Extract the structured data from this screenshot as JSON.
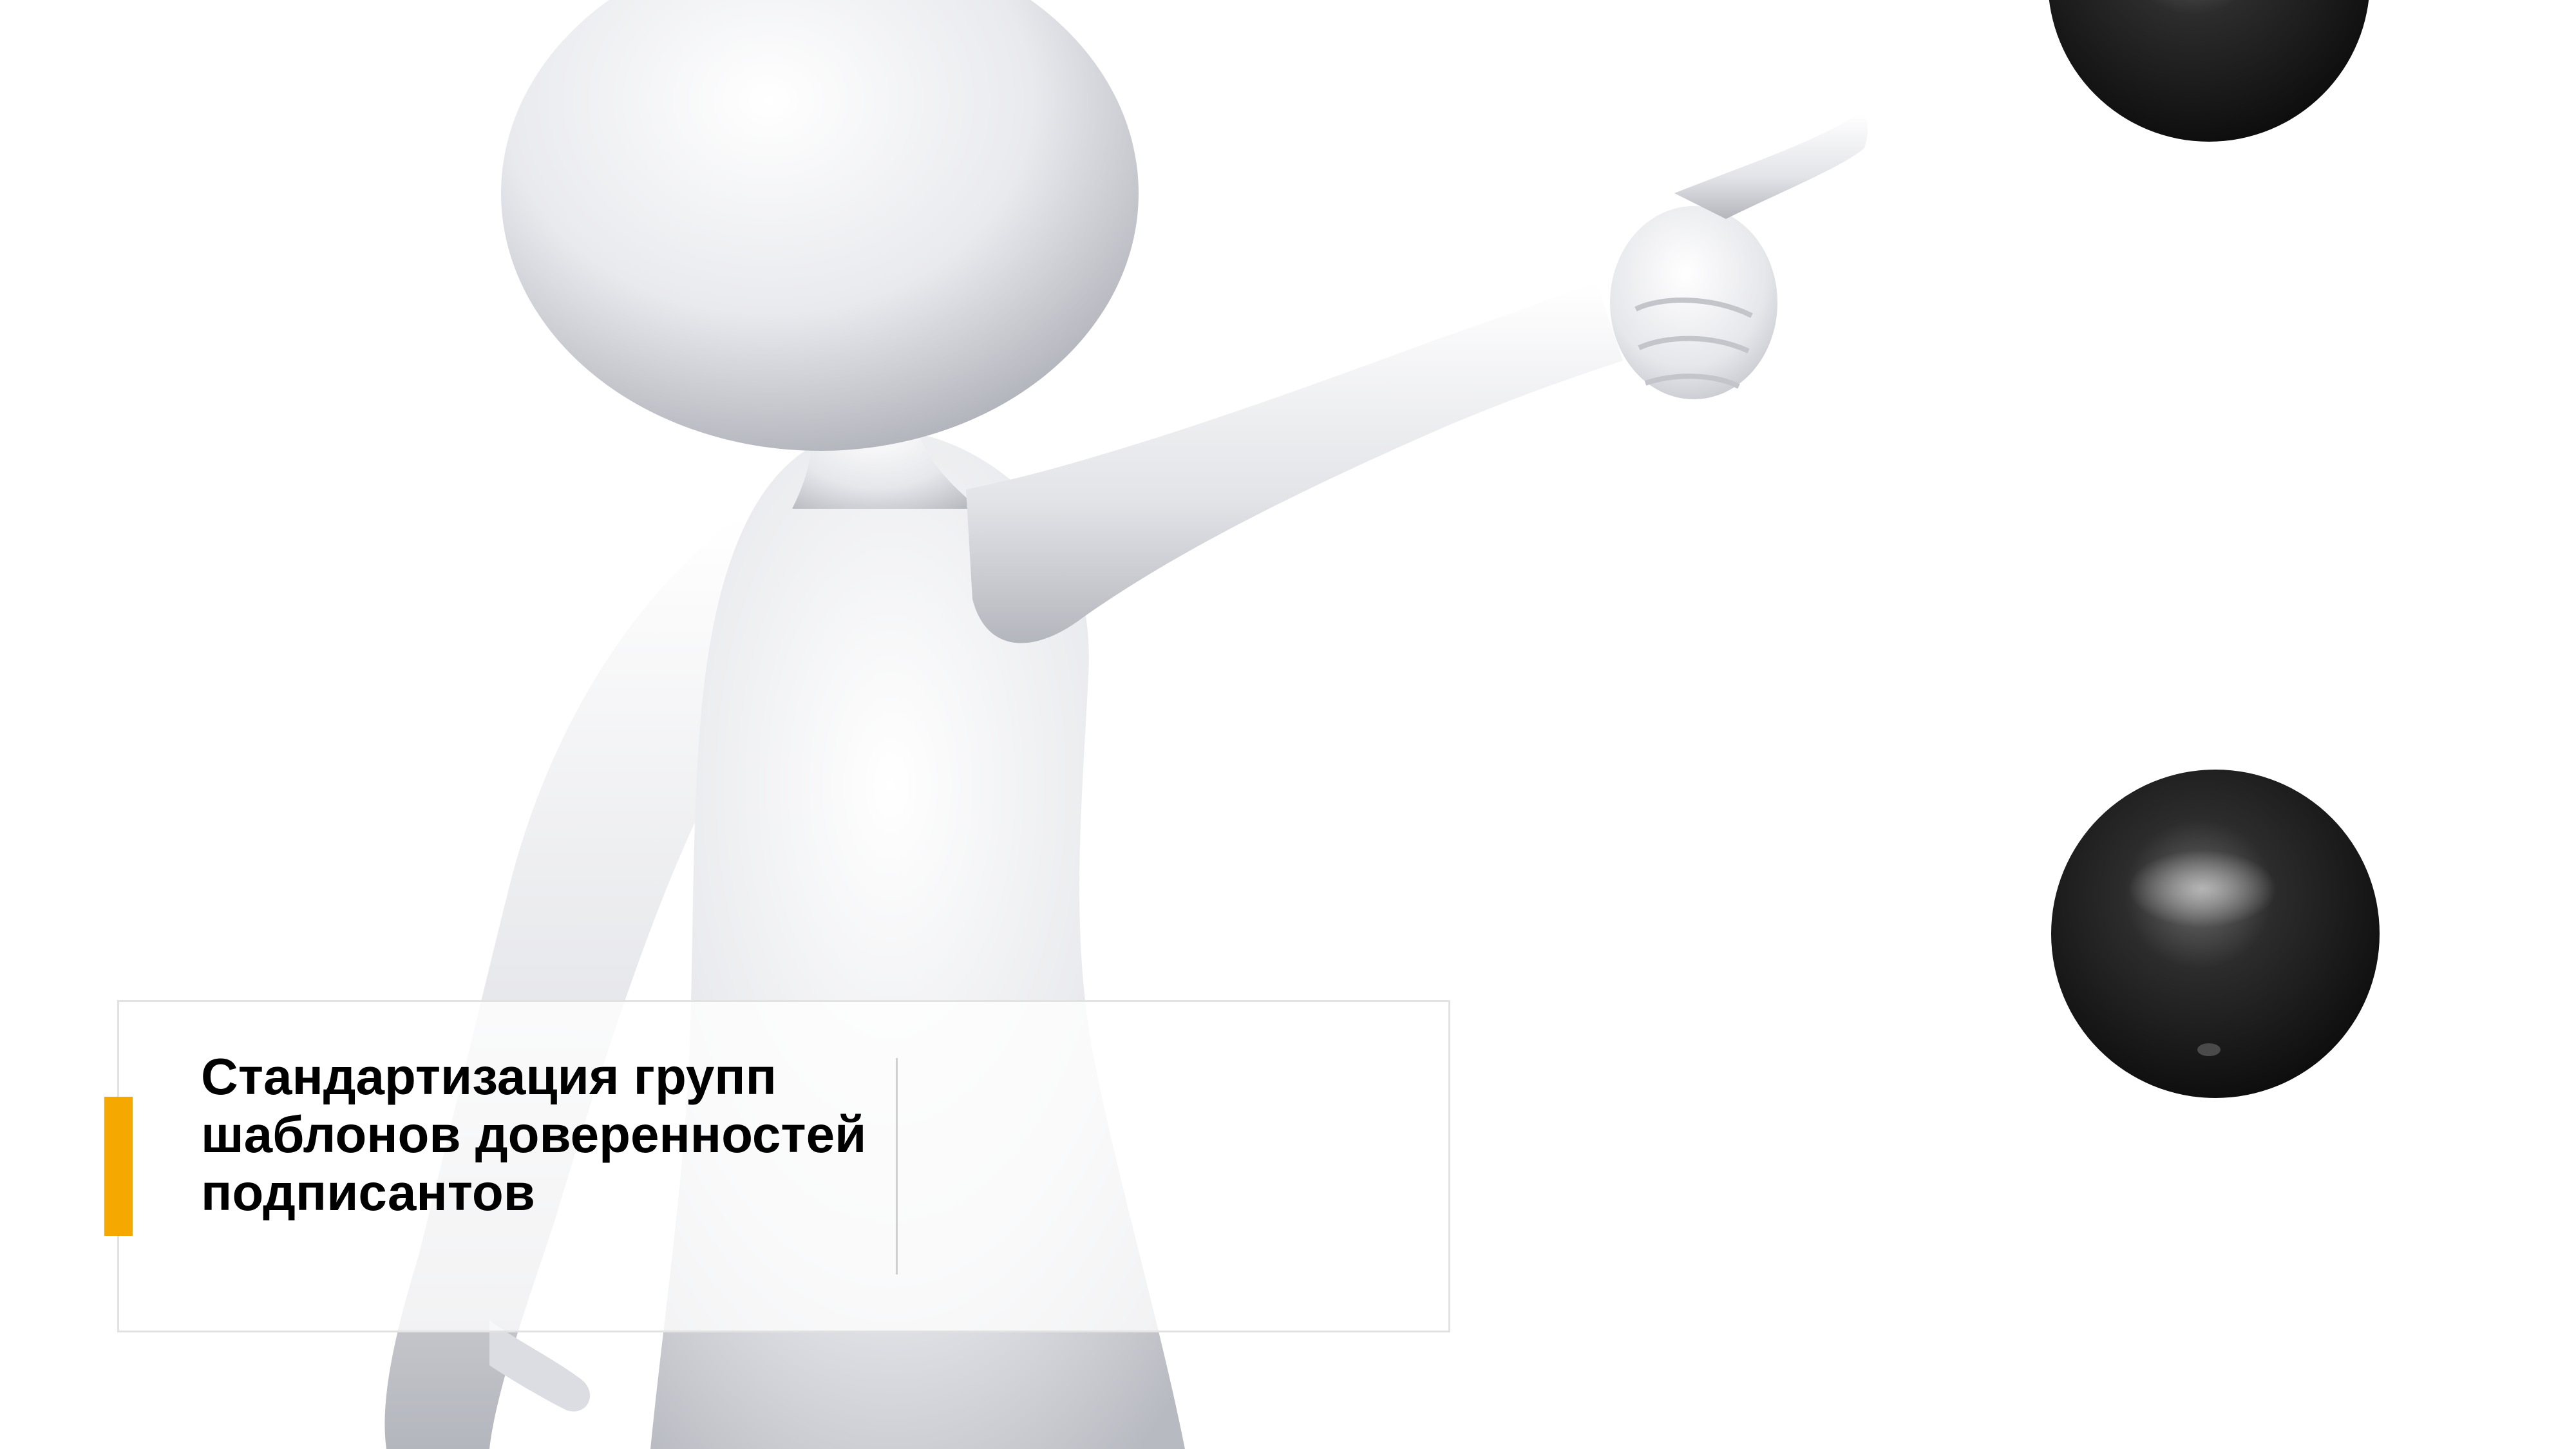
{
  "slide": {
    "title": "Стандартизация групп шаблонов доверенностей подписантов"
  },
  "colors": {
    "accent": "#f5a800",
    "card_border": "#e2e2e2",
    "divider": "#cfcfcf",
    "text": "#000000",
    "sphere": "#1e1e1e"
  }
}
